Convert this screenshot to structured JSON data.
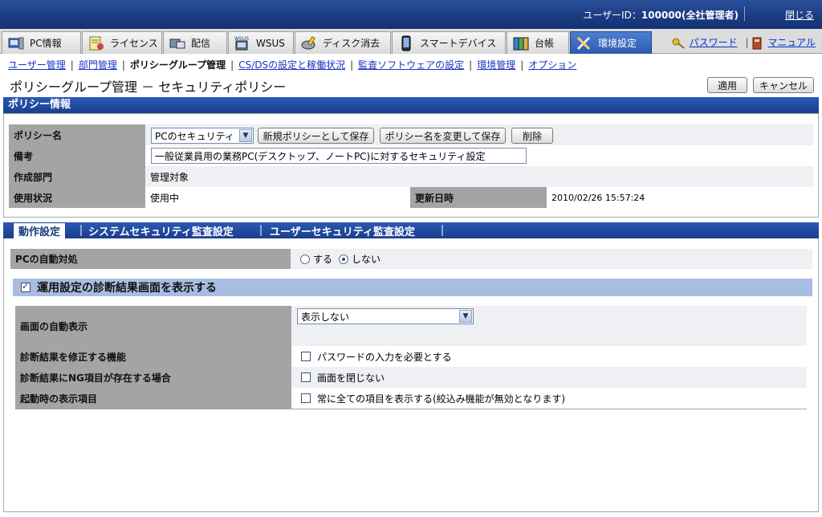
{
  "header": {
    "user_label": "ユーザーID：",
    "user_value": "100000(全社管理者)",
    "close_link": "閉じる"
  },
  "main_tabs": [
    {
      "label": "PC情報",
      "icon": "pc-icon"
    },
    {
      "label": "ライセンス",
      "icon": "license-icon"
    },
    {
      "label": "配信",
      "icon": "distribution-icon"
    },
    {
      "label": "WSUS",
      "icon": "wsus-icon"
    },
    {
      "label": "ディスク消去",
      "icon": "disk-erase-icon"
    },
    {
      "label": "スマートデバイス",
      "icon": "smart-device-icon"
    },
    {
      "label": "台帳",
      "icon": "ledger-icon"
    },
    {
      "label": "環境設定",
      "icon": "tools-icon",
      "active": true
    }
  ],
  "right_links": {
    "password": "パスワード",
    "manual": "マニュアル"
  },
  "subnav": {
    "user_mgmt": "ユーザー管理",
    "dept_mgmt": "部門管理",
    "policy_group": "ポリシーグループ管理",
    "csds": "CS/DSの設定と稼働状況",
    "audit_sw": "監査ソフトウェアの設定",
    "env_mgmt": "環境管理",
    "options": "オプション"
  },
  "page_title": "ポリシーグループ管理 － セキュリティポリシー",
  "buttons": {
    "apply": "適用",
    "cancel": "キャンセル"
  },
  "policy_info": {
    "section_title": "ポリシー情報",
    "name_label": "ポリシー名",
    "name_value": "PCのセキュリティ",
    "save_new": "新規ポリシーとして保存",
    "rename_save": "ポリシー名を変更して保存",
    "delete": "削除",
    "note_label": "備考",
    "note_value": "一般従業員用の業務PC(デスクトップ、ノートPC)に対するセキュリティ設定",
    "dept_label": "作成部門",
    "dept_value": "管理対象",
    "status_label": "使用状況",
    "status_value": "使用中",
    "updated_label": "更新日時",
    "updated_value": "2010/02/26 15:57:24"
  },
  "sub_tabs": {
    "action": "動作設定",
    "system_audit": "システムセキュリティ監査設定",
    "user_audit": "ユーザーセキュリティ監査設定"
  },
  "auto_action": {
    "label": "PCの自動対処",
    "opt_yes": "する",
    "opt_no": "しない",
    "selected": "しない"
  },
  "diagnosis": {
    "header": "運用設定の診断結果画面を表示する",
    "auto_display_label": "画面の自動表示",
    "auto_display_value": "表示しない",
    "fix_label": "診断結果を修正する機能",
    "fix_option": "パスワードの入力を必要とする",
    "ng_label": "診断結果にNG項目が存在する場合",
    "ng_option": "画面を閉じない",
    "startup_label": "起動時の表示項目",
    "startup_option": "常に全ての項目を表示する(絞込み機能が無効となります)"
  }
}
